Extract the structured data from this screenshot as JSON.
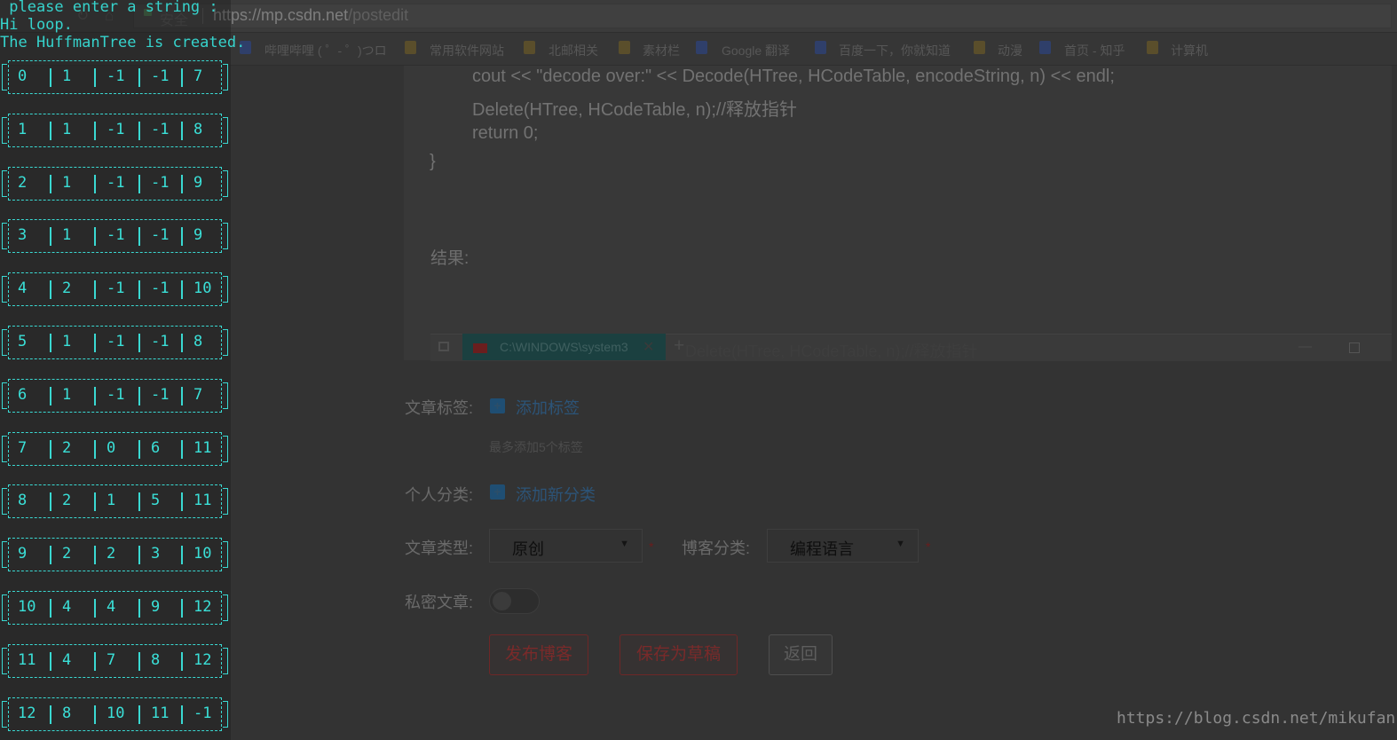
{
  "browser": {
    "secure_label": "安全",
    "url_host": "https://mp.csdn.net",
    "url_path": "/postedit",
    "bookmarks": [
      {
        "label": "哔哩哔哩 ( ゜- ゜)つロ"
      },
      {
        "label": "常用软件网站"
      },
      {
        "label": "北邮相关"
      },
      {
        "label": "素材栏"
      },
      {
        "label": "Google 翻译"
      },
      {
        "label": "百度一下，你就知道"
      },
      {
        "label": "动漫"
      },
      {
        "label": "首页 - 知乎"
      },
      {
        "label": "计算机"
      }
    ]
  },
  "editor": {
    "code_lines": [
      "cout << \"decode over:\" << Decode(HTree, HCodeTable, encodeString, n) << endl;",
      "Delete(HTree, HCodeTable, n);//释放指针",
      "return 0;",
      "}"
    ],
    "result_label": "结果:",
    "taskbar_title": "C:\\WINDOWS\\system3",
    "taskbar_ghost": "Delete(HTree, HCodeTable, n);//释放指针"
  },
  "form": {
    "tags_label": "文章标签:",
    "add_tag": "添加标签",
    "tag_hint": "最多添加5个标签",
    "category_label": "个人分类:",
    "add_category": "添加新分类",
    "type_label": "文章类型:",
    "type_value": "原创",
    "blog_category_label": "博客分类:",
    "blog_category_value": "编程语言",
    "private_label": "私密文章:",
    "publish_button": "发布博客",
    "draft_button": "保存为草稿",
    "back_button": "返回"
  },
  "console": {
    "lines": [
      " please enter a string :",
      "Hi loop.",
      "The HuffmanTree is created."
    ],
    "rows": [
      [
        "0",
        "1",
        "-1",
        "-1",
        "7"
      ],
      [
        "1",
        "1",
        "-1",
        "-1",
        "8"
      ],
      [
        "2",
        "1",
        "-1",
        "-1",
        "9"
      ],
      [
        "3",
        "1",
        "-1",
        "-1",
        "9"
      ],
      [
        "4",
        "2",
        "-1",
        "-1",
        "10"
      ],
      [
        "5",
        "1",
        "-1",
        "-1",
        "8"
      ],
      [
        "6",
        "1",
        "-1",
        "-1",
        "7"
      ],
      [
        "7",
        "2",
        "0",
        "6",
        "11"
      ],
      [
        "8",
        "2",
        "1",
        "5",
        "11"
      ],
      [
        "9",
        "2",
        "2",
        "3",
        "10"
      ],
      [
        "10",
        "4",
        "4",
        "9",
        "12"
      ],
      [
        "11",
        "4",
        "7",
        "8",
        "12"
      ],
      [
        "12",
        "8",
        "10",
        "11",
        "-1"
      ]
    ]
  },
  "watermark": "https://blog.csdn.net/mikufanL"
}
